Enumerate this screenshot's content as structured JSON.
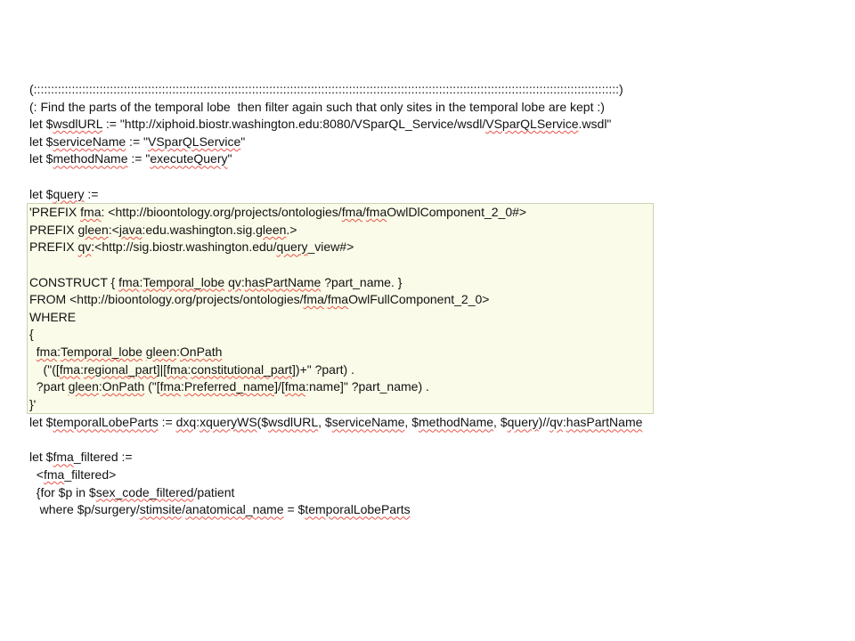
{
  "document": {
    "lines_before": [
      "(:::::::::::::::::::::::::::::::::::::::::::::::::::::::::::::::::::::::::::::::::::::::::::::::::::::::::::::::::::::::::::::::::::::::::::::::::::::::::::::::::::::::::)",
      "(: Find the parts of the temporal lobe  then filter again such that only sites in the temporal lobe are kept :)",
      "let $wsdlURL := \"http://xiphoid.biostr.washington.edu:8080/VSparQL_Service/wsdl/VSparQLService.wsdl\"",
      "let $serviceName := \"VSparQLService\"",
      "let $methodName := \"executeQuery\"",
      "",
      "let $query :="
    ],
    "query_lines": [
      "'PREFIX fma: <http://bioontology.org/projects/ontologies/fma/fmaOwlDlComponent_2_0#>",
      "PREFIX gleen:<java:edu.washington.sig.gleen.>",
      "PREFIX qv:<http://sig.biostr.washington.edu/query_view#>",
      "",
      "CONSTRUCT { fma:Temporal_lobe qv:hasPartName ?part_name. }",
      "FROM <http://bioontology.org/projects/ontologies/fma/fmaOwlFullComponent_2_0>",
      "WHERE",
      "{",
      "  fma:Temporal_lobe gleen:OnPath",
      "    (\"([fma:regional_part]|[fma:constitutional_part])+\" ?part) .",
      "  ?part gleen:OnPath (\"[fma:Preferred_name]/[fma:name]\" ?part_name) .",
      "}'"
    ],
    "lines_after": [
      "let $temporalLobeParts := dxq:xqueryWS($wsdlURL, $serviceName, $methodName, $query)//qv:hasPartName",
      "",
      "let $fma_filtered :=",
      "  <fma_filtered>",
      "  {for $p in $sex_code_filtered/patient",
      "   where $p/surgery/stimsite/anatomical_name = $temporalLobeParts"
    ]
  },
  "colors": {
    "text": "#111111",
    "query_background": "#fbfbe9",
    "query_border": "#c9d3b3",
    "spellcheck_underline": "#e8534a"
  }
}
